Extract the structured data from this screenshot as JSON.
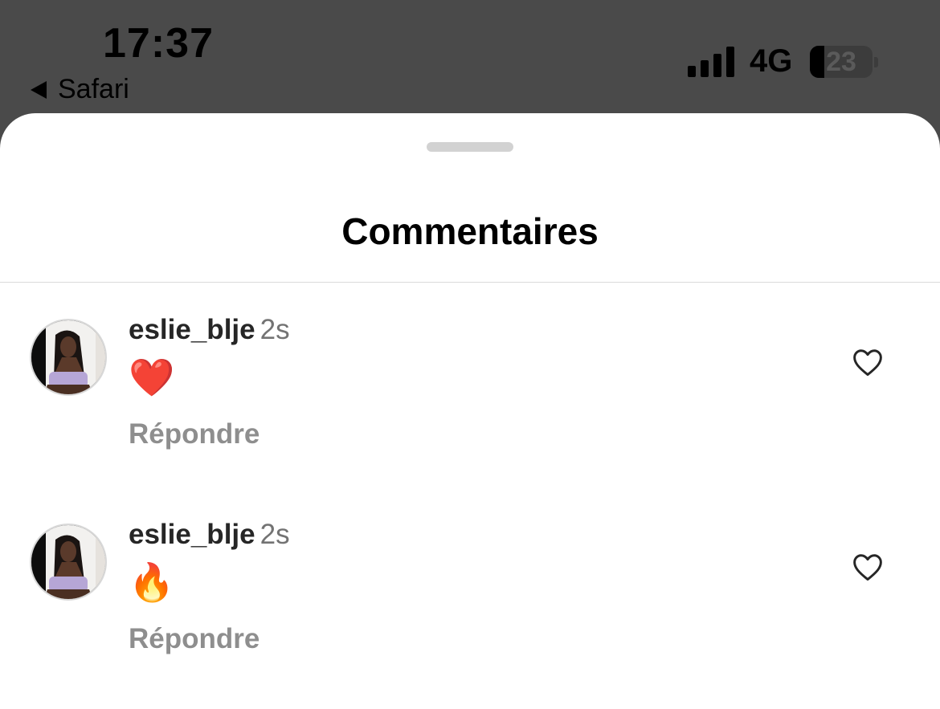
{
  "status_bar": {
    "time": "17:37",
    "back_app": "Safari",
    "network": "4G",
    "battery": "23"
  },
  "sheet": {
    "title": "Commentaires"
  },
  "comments": [
    {
      "username": "eslie_blje",
      "time": "2s",
      "text": "❤️",
      "reply_label": "Répondre"
    },
    {
      "username": "eslie_blje",
      "time": "2s",
      "text": "🔥",
      "reply_label": "Répondre"
    }
  ],
  "colors": {
    "dimmed_background": "#4a4a4a",
    "sheet": "#ffffff",
    "username": "#262626",
    "secondary_text": "#8e8e8e"
  },
  "icons": [
    "back-triangle-icon",
    "signal-icon",
    "battery-icon",
    "heart-outline-icon",
    "avatar-photo"
  ]
}
